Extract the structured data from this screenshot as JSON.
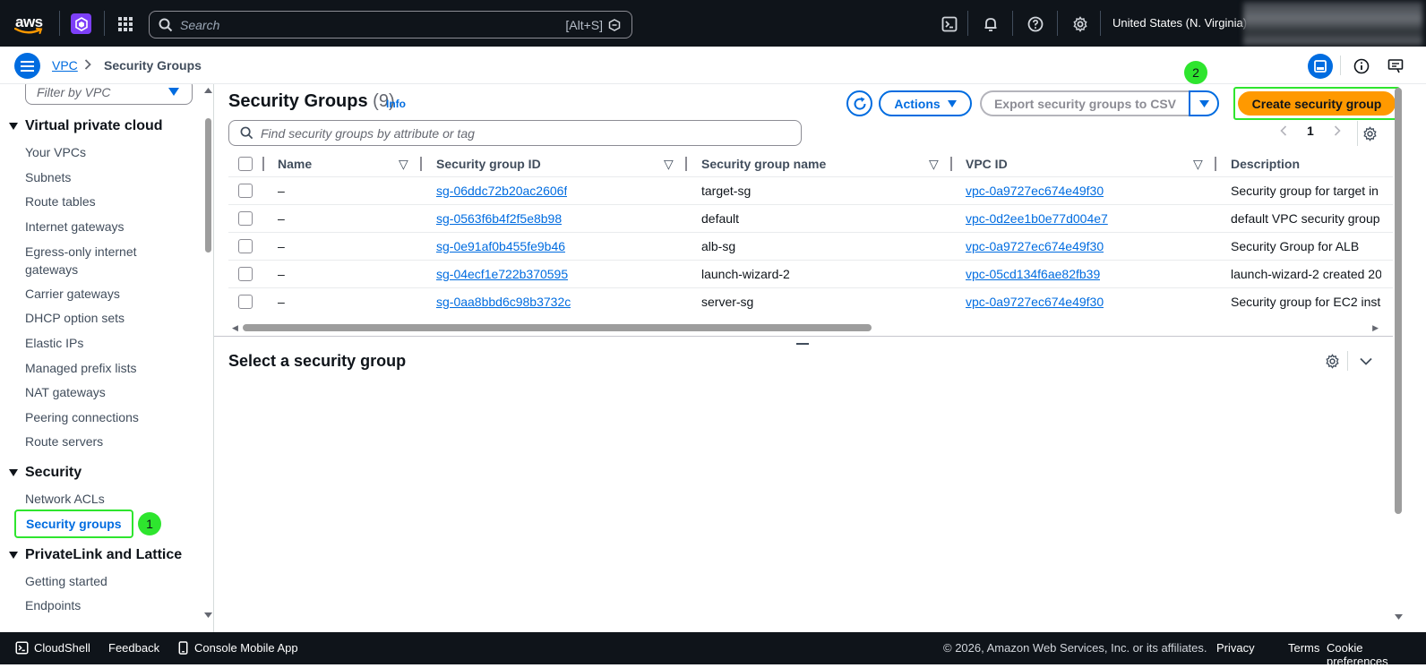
{
  "topnav": {
    "search_placeholder": "Search",
    "search_shortcut": "[Alt+S]",
    "region": "United States (N. Virginia)",
    "aws_logo_text": "aws"
  },
  "breadcrumb": {
    "root": "VPC",
    "current": "Security Groups"
  },
  "sidebar": {
    "filter_placeholder": "Filter by VPC",
    "sections": {
      "vpc": "Virtual private cloud",
      "security": "Security",
      "privatelink": "PrivateLink and Lattice"
    },
    "vpc_items": [
      "Your VPCs",
      "Subnets",
      "Route tables",
      "Internet gateways",
      "Egress-only internet gateways",
      "Carrier gateways",
      "DHCP option sets",
      "Elastic IPs",
      "Managed prefix lists",
      "NAT gateways",
      "Peering connections",
      "Route servers"
    ],
    "security_items": [
      "Network ACLs",
      "Security groups"
    ],
    "privatelink_items": [
      "Getting started",
      "Endpoints"
    ],
    "badge_1": "1"
  },
  "main": {
    "title": "Security Groups",
    "count": "(9)",
    "info": "Info",
    "actions_label": "Actions",
    "export_label": "Export security groups to CSV",
    "create_label": "Create security group",
    "badge_2": "2",
    "find_placeholder": "Find security groups by attribute or tag",
    "page": "1",
    "columns": [
      "Name",
      "Security group ID",
      "Security group name",
      "VPC ID",
      "Description"
    ],
    "rows": [
      {
        "name": "–",
        "id": "sg-06ddc72b20ac2606f",
        "sg_name": "target-sg",
        "vpc": "vpc-0a9727ec674e49f30",
        "desc": "Security group for target in"
      },
      {
        "name": "–",
        "id": "sg-0563f6b4f2f5e8b98",
        "sg_name": "default",
        "vpc": "vpc-0d2ee1b0e77d004e7",
        "desc": "default VPC security group"
      },
      {
        "name": "–",
        "id": "sg-0e91af0b455fe9b46",
        "sg_name": "alb-sg",
        "vpc": "vpc-0a9727ec674e49f30",
        "desc": "Security Group for ALB"
      },
      {
        "name": "–",
        "id": "sg-04ecf1e722b370595",
        "sg_name": "launch-wizard-2",
        "vpc": "vpc-05cd134f6ae82fb39",
        "desc": "launch-wizard-2 created 20"
      },
      {
        "name": "–",
        "id": "sg-0aa8bbd6c98b3732c",
        "sg_name": "server-sg",
        "vpc": "vpc-0a9727ec674e49f30",
        "desc": "Security group for EC2 inst"
      }
    ],
    "detail_title": "Select a security group"
  },
  "footer": {
    "cloudshell": "CloudShell",
    "feedback": "Feedback",
    "mobile": "Console Mobile App",
    "copyright": "© 2026, Amazon Web Services, Inc. or its affiliates.",
    "privacy": "Privacy",
    "terms": "Terms",
    "cookies": "Cookie preferences"
  },
  "colors": {
    "nav_bg": "#0f141a",
    "link": "#006ce0",
    "primary_button": "#ff9900",
    "highlight": "#2ee52e"
  }
}
